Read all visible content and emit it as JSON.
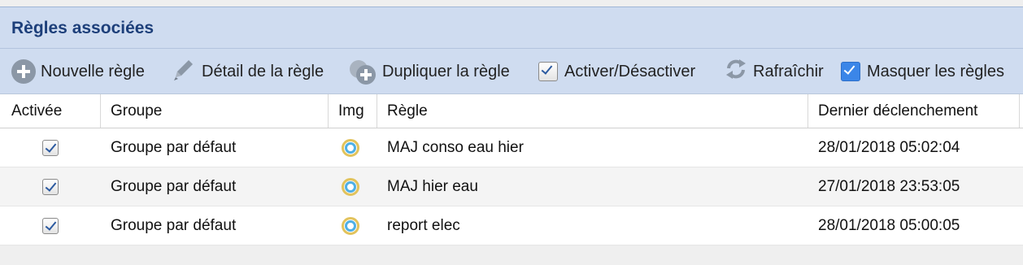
{
  "panel": {
    "title": "Règles associées"
  },
  "toolbar": {
    "new_rule": "Nouvelle règle",
    "rule_detail": "Détail de la règle",
    "duplicate_rule": "Dupliquer la règle",
    "toggle": "Activer/Désactiver",
    "refresh": "Rafraîchir",
    "hide_rules": "Masquer les règles"
  },
  "table": {
    "headers": {
      "active": "Activée",
      "group": "Groupe",
      "img": "Img",
      "rule": "Règle",
      "last_trigger": "Dernier déclenchement"
    },
    "rows": [
      {
        "active": true,
        "group": "Groupe par défaut",
        "icon": "ring-icon",
        "rule": "MAJ conso eau hier",
        "last_trigger": "28/01/2018 05:02:04"
      },
      {
        "active": true,
        "group": "Groupe par défaut",
        "icon": "ring-icon",
        "rule": "MAJ hier eau",
        "last_trigger": "27/01/2018 23:53:05"
      },
      {
        "active": true,
        "group": "Groupe par défaut",
        "icon": "ring-icon",
        "rule": "report elec",
        "last_trigger": "28/01/2018 05:00:05"
      }
    ]
  },
  "colors": {
    "header_bg": "#cfdcf0",
    "title_color": "#1d3f7a",
    "checkbox_blue": "#3b86e8"
  }
}
